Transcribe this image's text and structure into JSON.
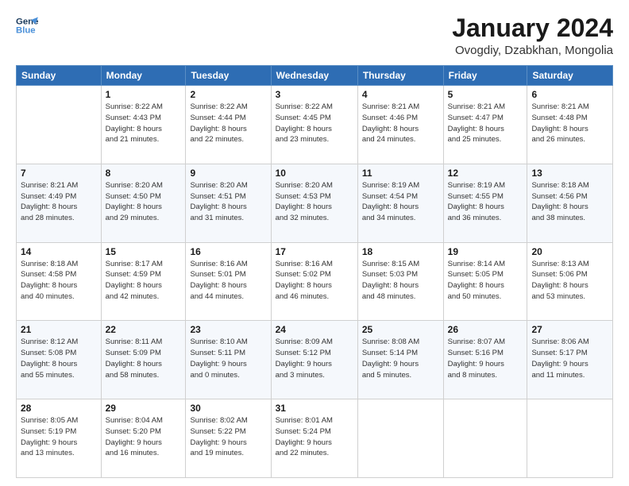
{
  "logo": {
    "line1": "General",
    "line2": "Blue"
  },
  "title": "January 2024",
  "location": "Ovogdiy, Dzabkhan, Mongolia",
  "weekdays": [
    "Sunday",
    "Monday",
    "Tuesday",
    "Wednesday",
    "Thursday",
    "Friday",
    "Saturday"
  ],
  "weeks": [
    [
      {
        "day": "",
        "info": ""
      },
      {
        "day": "1",
        "info": "Sunrise: 8:22 AM\nSunset: 4:43 PM\nDaylight: 8 hours\nand 21 minutes."
      },
      {
        "day": "2",
        "info": "Sunrise: 8:22 AM\nSunset: 4:44 PM\nDaylight: 8 hours\nand 22 minutes."
      },
      {
        "day": "3",
        "info": "Sunrise: 8:22 AM\nSunset: 4:45 PM\nDaylight: 8 hours\nand 23 minutes."
      },
      {
        "day": "4",
        "info": "Sunrise: 8:21 AM\nSunset: 4:46 PM\nDaylight: 8 hours\nand 24 minutes."
      },
      {
        "day": "5",
        "info": "Sunrise: 8:21 AM\nSunset: 4:47 PM\nDaylight: 8 hours\nand 25 minutes."
      },
      {
        "day": "6",
        "info": "Sunrise: 8:21 AM\nSunset: 4:48 PM\nDaylight: 8 hours\nand 26 minutes."
      }
    ],
    [
      {
        "day": "7",
        "info": ""
      },
      {
        "day": "8",
        "info": "Sunrise: 8:20 AM\nSunset: 4:50 PM\nDaylight: 8 hours\nand 29 minutes."
      },
      {
        "day": "9",
        "info": "Sunrise: 8:20 AM\nSunset: 4:51 PM\nDaylight: 8 hours\nand 31 minutes."
      },
      {
        "day": "10",
        "info": "Sunrise: 8:20 AM\nSunset: 4:53 PM\nDaylight: 8 hours\nand 32 minutes."
      },
      {
        "day": "11",
        "info": "Sunrise: 8:19 AM\nSunset: 4:54 PM\nDaylight: 8 hours\nand 34 minutes."
      },
      {
        "day": "12",
        "info": "Sunrise: 8:19 AM\nSunset: 4:55 PM\nDaylight: 8 hours\nand 36 minutes."
      },
      {
        "day": "13",
        "info": "Sunrise: 8:18 AM\nSunset: 4:56 PM\nDaylight: 8 hours\nand 38 minutes."
      }
    ],
    [
      {
        "day": "14",
        "info": ""
      },
      {
        "day": "15",
        "info": "Sunrise: 8:17 AM\nSunset: 4:59 PM\nDaylight: 8 hours\nand 42 minutes."
      },
      {
        "day": "16",
        "info": "Sunrise: 8:16 AM\nSunset: 5:01 PM\nDaylight: 8 hours\nand 44 minutes."
      },
      {
        "day": "17",
        "info": "Sunrise: 8:16 AM\nSunset: 5:02 PM\nDaylight: 8 hours\nand 46 minutes."
      },
      {
        "day": "18",
        "info": "Sunrise: 8:15 AM\nSunset: 5:03 PM\nDaylight: 8 hours\nand 48 minutes."
      },
      {
        "day": "19",
        "info": "Sunrise: 8:14 AM\nSunset: 5:05 PM\nDaylight: 8 hours\nand 50 minutes."
      },
      {
        "day": "20",
        "info": "Sunrise: 8:13 AM\nSunset: 5:06 PM\nDaylight: 8 hours\nand 53 minutes."
      }
    ],
    [
      {
        "day": "21",
        "info": ""
      },
      {
        "day": "22",
        "info": "Sunrise: 8:11 AM\nSunset: 5:09 PM\nDaylight: 8 hours\nand 58 minutes."
      },
      {
        "day": "23",
        "info": "Sunrise: 8:10 AM\nSunset: 5:11 PM\nDaylight: 9 hours\nand 0 minutes."
      },
      {
        "day": "24",
        "info": "Sunrise: 8:09 AM\nSunset: 5:12 PM\nDaylight: 9 hours\nand 3 minutes."
      },
      {
        "day": "25",
        "info": "Sunrise: 8:08 AM\nSunset: 5:14 PM\nDaylight: 9 hours\nand 5 minutes."
      },
      {
        "day": "26",
        "info": "Sunrise: 8:07 AM\nSunset: 5:16 PM\nDaylight: 9 hours\nand 8 minutes."
      },
      {
        "day": "27",
        "info": "Sunrise: 8:06 AM\nSunset: 5:17 PM\nDaylight: 9 hours\nand 11 minutes."
      }
    ],
    [
      {
        "day": "28",
        "info": "Sunrise: 8:05 AM\nSunset: 5:19 PM\nDaylight: 9 hours\nand 13 minutes."
      },
      {
        "day": "29",
        "info": "Sunrise: 8:04 AM\nSunset: 5:20 PM\nDaylight: 9 hours\nand 16 minutes."
      },
      {
        "day": "30",
        "info": "Sunrise: 8:02 AM\nSunset: 5:22 PM\nDaylight: 9 hours\nand 19 minutes."
      },
      {
        "day": "31",
        "info": "Sunrise: 8:01 AM\nSunset: 5:24 PM\nDaylight: 9 hours\nand 22 minutes."
      },
      {
        "day": "",
        "info": ""
      },
      {
        "day": "",
        "info": ""
      },
      {
        "day": "",
        "info": ""
      }
    ]
  ],
  "week1_sun_info": "Sunrise: 8:21 AM\nSunset: 4:49 PM\nDaylight: 8 hours\nand 28 minutes.",
  "week3_sun_info": "Sunrise: 8:18 AM\nSunset: 4:58 PM\nDaylight: 8 hours\nand 40 minutes.",
  "week4_sun_info": "Sunrise: 8:12 AM\nSunset: 5:08 PM\nDaylight: 8 hours\nand 55 minutes."
}
